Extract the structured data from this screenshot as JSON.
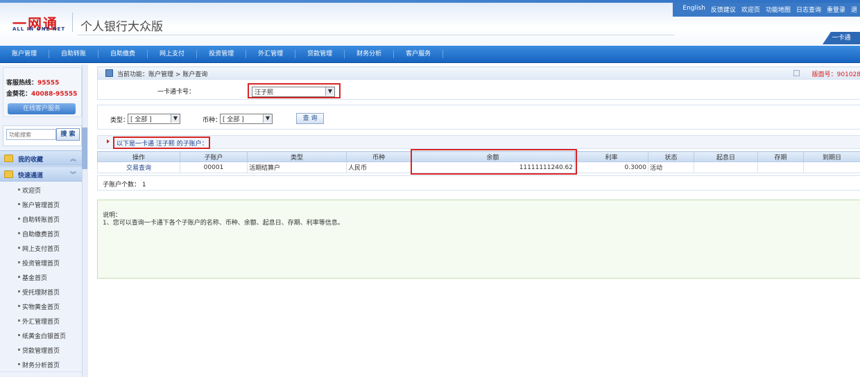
{
  "header": {
    "logo_cn": "一网通",
    "logo_en": "ALL IN ONE NET",
    "app_title": "个人银行大众版",
    "top_links": [
      "English",
      "反馈建议",
      "欢迎页",
      "功能地图",
      "日志查询",
      "重登录",
      "退"
    ],
    "card_tab": "一卡通"
  },
  "nav": {
    "items": [
      "账户管理",
      "自助转账",
      "自助缴费",
      "网上支付",
      "投资管理",
      "外汇管理",
      "贷款管理",
      "财务分析",
      "客户服务"
    ]
  },
  "sidebar": {
    "hotline_label": "客服热线：",
    "hotline_value": "95555",
    "jinkuihua_label": "金葵花：",
    "jinkuihua_value": "40088-95555",
    "cs_button": "在线客户服务",
    "search_placeholder": "功能搜索",
    "search_button": "搜 索",
    "favorites_label": "我的收藏",
    "quick_label": "快速通道",
    "menu_items": [
      "欢迎页",
      "账户管理首页",
      "自助转账首页",
      "自助缴费首页",
      "网上支付首页",
      "投资管理首页",
      "基金首页",
      "受托理财首页",
      "实物黄金首页",
      "外汇管理首页",
      "纸黄金白银首页",
      "贷款管理首页",
      "财务分析首页"
    ]
  },
  "main": {
    "breadcrumb": "当前功能：账户管理 > 账户查询",
    "version": "版面号：901028",
    "card_label": "一卡通卡号：",
    "card_value": "汪子熙",
    "type_label": "类型：",
    "type_value": "[ 全部 ]",
    "currency_label": "币种：",
    "currency_value": "[ 全部 ]",
    "query_button": "查 询",
    "info_text": "以下是一卡通 汪子熙 的子账户：",
    "table": {
      "headers": [
        "操作",
        "子账户",
        "类型",
        "币种",
        "余额",
        "利率",
        "状态",
        "起息日",
        "存期",
        "到期日"
      ],
      "rows": [
        [
          "交易查询",
          "00001",
          "活期结算户",
          "人民币",
          "11111111240.62",
          "0.3000",
          "活动",
          "",
          "",
          ""
        ]
      ]
    },
    "count_text": "子账户个数： 1",
    "note_title": "说明：",
    "note_line": "1、您可以查询一卡通下各个子账户的名称、币种、余额、起息日、存期、利率等信息。"
  }
}
